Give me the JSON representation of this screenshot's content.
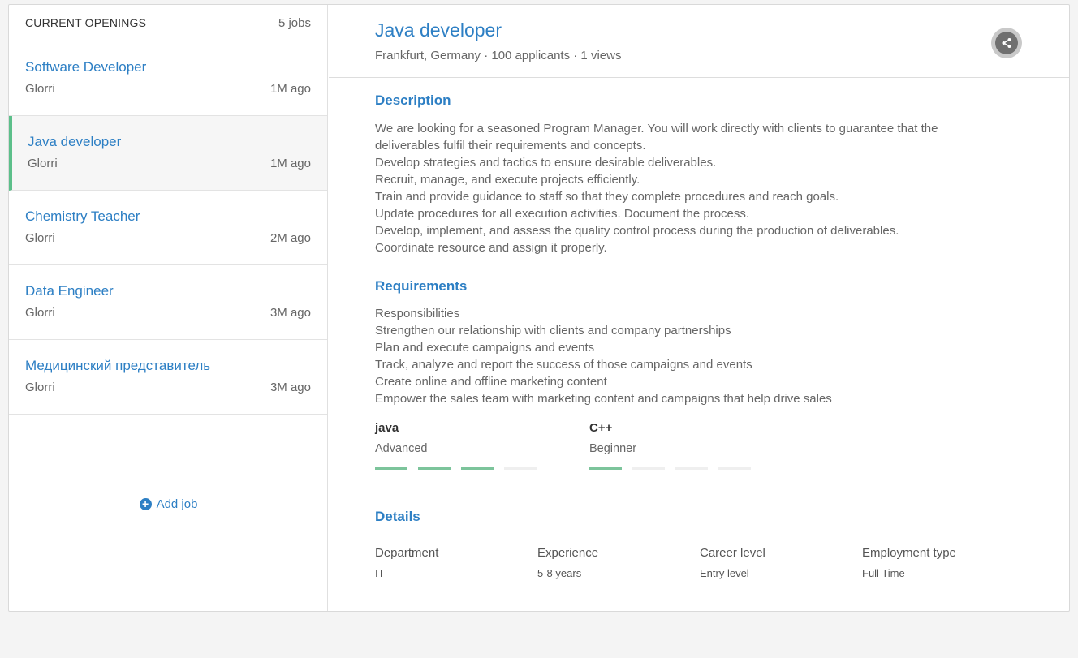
{
  "sidebar": {
    "title": "CURRENT OPENINGS",
    "count": "5 jobs",
    "jobs": [
      {
        "title": "Software Developer",
        "company": "Glorri",
        "age": "1M ago",
        "active": false
      },
      {
        "title": "Java developer",
        "company": "Glorri",
        "age": "1M ago",
        "active": true
      },
      {
        "title": "Chemistry Teacher",
        "company": "Glorri",
        "age": "2M ago",
        "active": false
      },
      {
        "title": "Data Engineer",
        "company": "Glorri",
        "age": "3M ago",
        "active": false
      },
      {
        "title": "Медицинский представитель",
        "company": "Glorri",
        "age": "3M ago",
        "active": false
      }
    ],
    "add_job_label": "Add job"
  },
  "job": {
    "title": "Java developer",
    "meta": "Frankfurt, Germany · 100 applicants · 1 views",
    "description_title": "Description",
    "description_lines": [
      "We are looking for a seasoned Program Manager. You will work directly with clients to guarantee that the",
      "deliverables fulfil their requirements and concepts.",
      "Develop strategies and tactics to ensure desirable deliverables.",
      "Recruit, manage, and execute projects efficiently.",
      "Train and provide guidance to staff so that they complete procedures and reach goals.",
      "Update procedures for all execution activities. Document the process.",
      "Develop, implement, and assess the quality control process during the production of deliverables.",
      "Coordinate resource and assign it properly."
    ],
    "requirements_title": "Requirements",
    "requirements_lines": [
      "Responsibilities",
      "Strengthen our relationship with clients and company partnerships",
      "Plan and execute campaigns and events",
      "Track, analyze and report the success of those campaigns and events",
      "Create online and offline marketing content",
      "Empower the sales team with marketing content and campaigns that help drive sales"
    ],
    "skills": [
      {
        "name": "java",
        "level": "Advanced",
        "filled": 3,
        "total": 4
      },
      {
        "name": "C++",
        "level": "Beginner",
        "filled": 1,
        "total": 4
      }
    ],
    "details_title": "Details",
    "details": [
      {
        "label": "Department",
        "value": "IT"
      },
      {
        "label": "Experience",
        "value": "5-8 years"
      },
      {
        "label": "Career level",
        "value": "Entry level"
      },
      {
        "label": "Employment type",
        "value": "Full Time"
      }
    ]
  },
  "colors": {
    "accent": "#2d7fc4",
    "active_border": "#5cbf8a",
    "skill_bar_on": "#7cc49b"
  },
  "icons": {
    "share": "share-icon",
    "add": "plus-circle-icon"
  }
}
